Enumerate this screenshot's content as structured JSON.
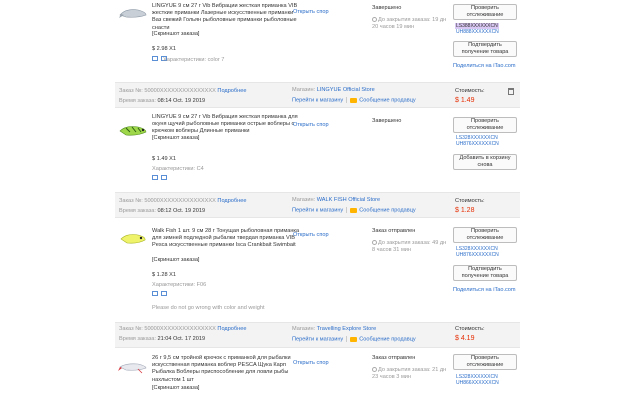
{
  "orders": [
    {
      "title": "LINGYUE 9 см 27 г Vib Вибрации жесткая приманка VIB жесткие приманки Лазерные искусственные приманки Ваз свежий Гольян рыболовные приманки рыболовные снасти",
      "snapshot": "[Скриншот заказа]",
      "price": "$ 2.98 X1",
      "attrs": "Характеристики: color 7",
      "open_dispute": "Открыть спор",
      "status": "Завершено",
      "countdown": "До закрытия заказа: 19 дн 20 часов 19 мин",
      "buttons": [
        "Проверить отслеживание",
        "Подтвердить получение товара"
      ],
      "track1": "LS388XXXXXXCN",
      "track2": "UH888XXXXXXCN",
      "share": "Поделиться на iTao.com"
    },
    {
      "order_no_label": "Заказ №: 50000XXXXXXXXXXXXXXX",
      "details": "Подробнее",
      "time_label": "Время заказа:",
      "time": "08:14 Oct. 19 2019",
      "store_label": "Магазин:",
      "store": "LINGYUE Official Store",
      "go_store": "Перейти к магазину",
      "message": "Сообщение продавцу",
      "cost_label": "Стоимость:",
      "cost": "$ 1.49",
      "title": "LINGYUE 9 см 27 г Vib Вибрация жесткая приманка для окуня щучий рыболовные приманки острые воблеры с крючком воблеры Длинные приманки",
      "snapshot": "[Скриншот заказа]",
      "price": "$ 1.49 X1",
      "attrs": "Характеристики: C4",
      "open_dispute": "Открыть спор",
      "status": "Завершено",
      "buttons": [
        "Проверить отслеживание",
        "Добавить в корзину снова"
      ],
      "track1": "LS328XXXXXXCN",
      "track2": "UH876XXXXXXCN",
      "share": "Поделиться на iTao.com"
    },
    {
      "order_no_label": "Заказ №: 50000XXXXXXXXXXXXXXX",
      "details": "Подробнее",
      "time_label": "Время заказа:",
      "time": "08:12 Oct. 19 2019",
      "store_label": "Магазин:",
      "store": "WALK FISH Official Store",
      "go_store": "Перейти к магазину",
      "message": "Сообщение продавцу",
      "cost_label": "Стоимость:",
      "cost": "$ 1.28",
      "title": "Walk Fish 1 шт. 9 см 28 г Тонущая рыболовная приманка для зимней подледной рыбалки твердая приманка VIB Pesca искусственные приманки Isca Crankbait Swimbait",
      "snapshot": "[Скриншот заказа]",
      "price": "$ 1.28 X1",
      "attrs": "Характеристики: F06",
      "note": "Please do not go wrong with color and weight",
      "open_dispute": "Открыть спор",
      "status": "Заказ отправлен",
      "countdown": "До закрытия заказа: 49 дн 8 часов 31 мин",
      "buttons": [
        "Проверить отслеживание",
        "Подтвердить получение товара"
      ],
      "track1": "LS328XXXXXXCN",
      "track2": "UH876XXXXXXCN",
      "share": "Поделиться на iTao.com"
    },
    {
      "order_no_label": "Заказ №: 50000XXXXXXXXXXXXXXX",
      "details": "Подробнее",
      "time_label": "Время заказа:",
      "time": "21:04 Oct. 17 2019",
      "store_label": "Магазин:",
      "store": "Travelling Explore Store",
      "go_store": "Перейти к магазину",
      "message": "Сообщение продавцу",
      "cost_label": "Стоимость:",
      "cost": "$ 4.19",
      "title": "26 г 9,5 см тройной крючок с приманкой для рыбалки искусственная приманка воблер PESCA Щука Карп Рыбалка Воблеры приспособление для ловли рыбы нахлыстом 1 шт",
      "snapshot": "[Скриншот заказа]",
      "open_dispute": "Открыть спор",
      "status": "Заказ отправлен",
      "countdown": "До закрытия заказа: 21 дн 23 часов 3 мин",
      "buttons": [
        "Проверить отслеживание"
      ],
      "track1": "LS328XXXXXXCN",
      "track2": "UH866XXXXXXCN"
    }
  ],
  "colors": {
    "accent": "#2a6dc9",
    "price": "#e62e04",
    "header_bg": "#f3f3f3"
  },
  "icons": [
    "gear-icon",
    "envelope-icon",
    "trash-icon",
    "clock-icon",
    "message-icon"
  ]
}
